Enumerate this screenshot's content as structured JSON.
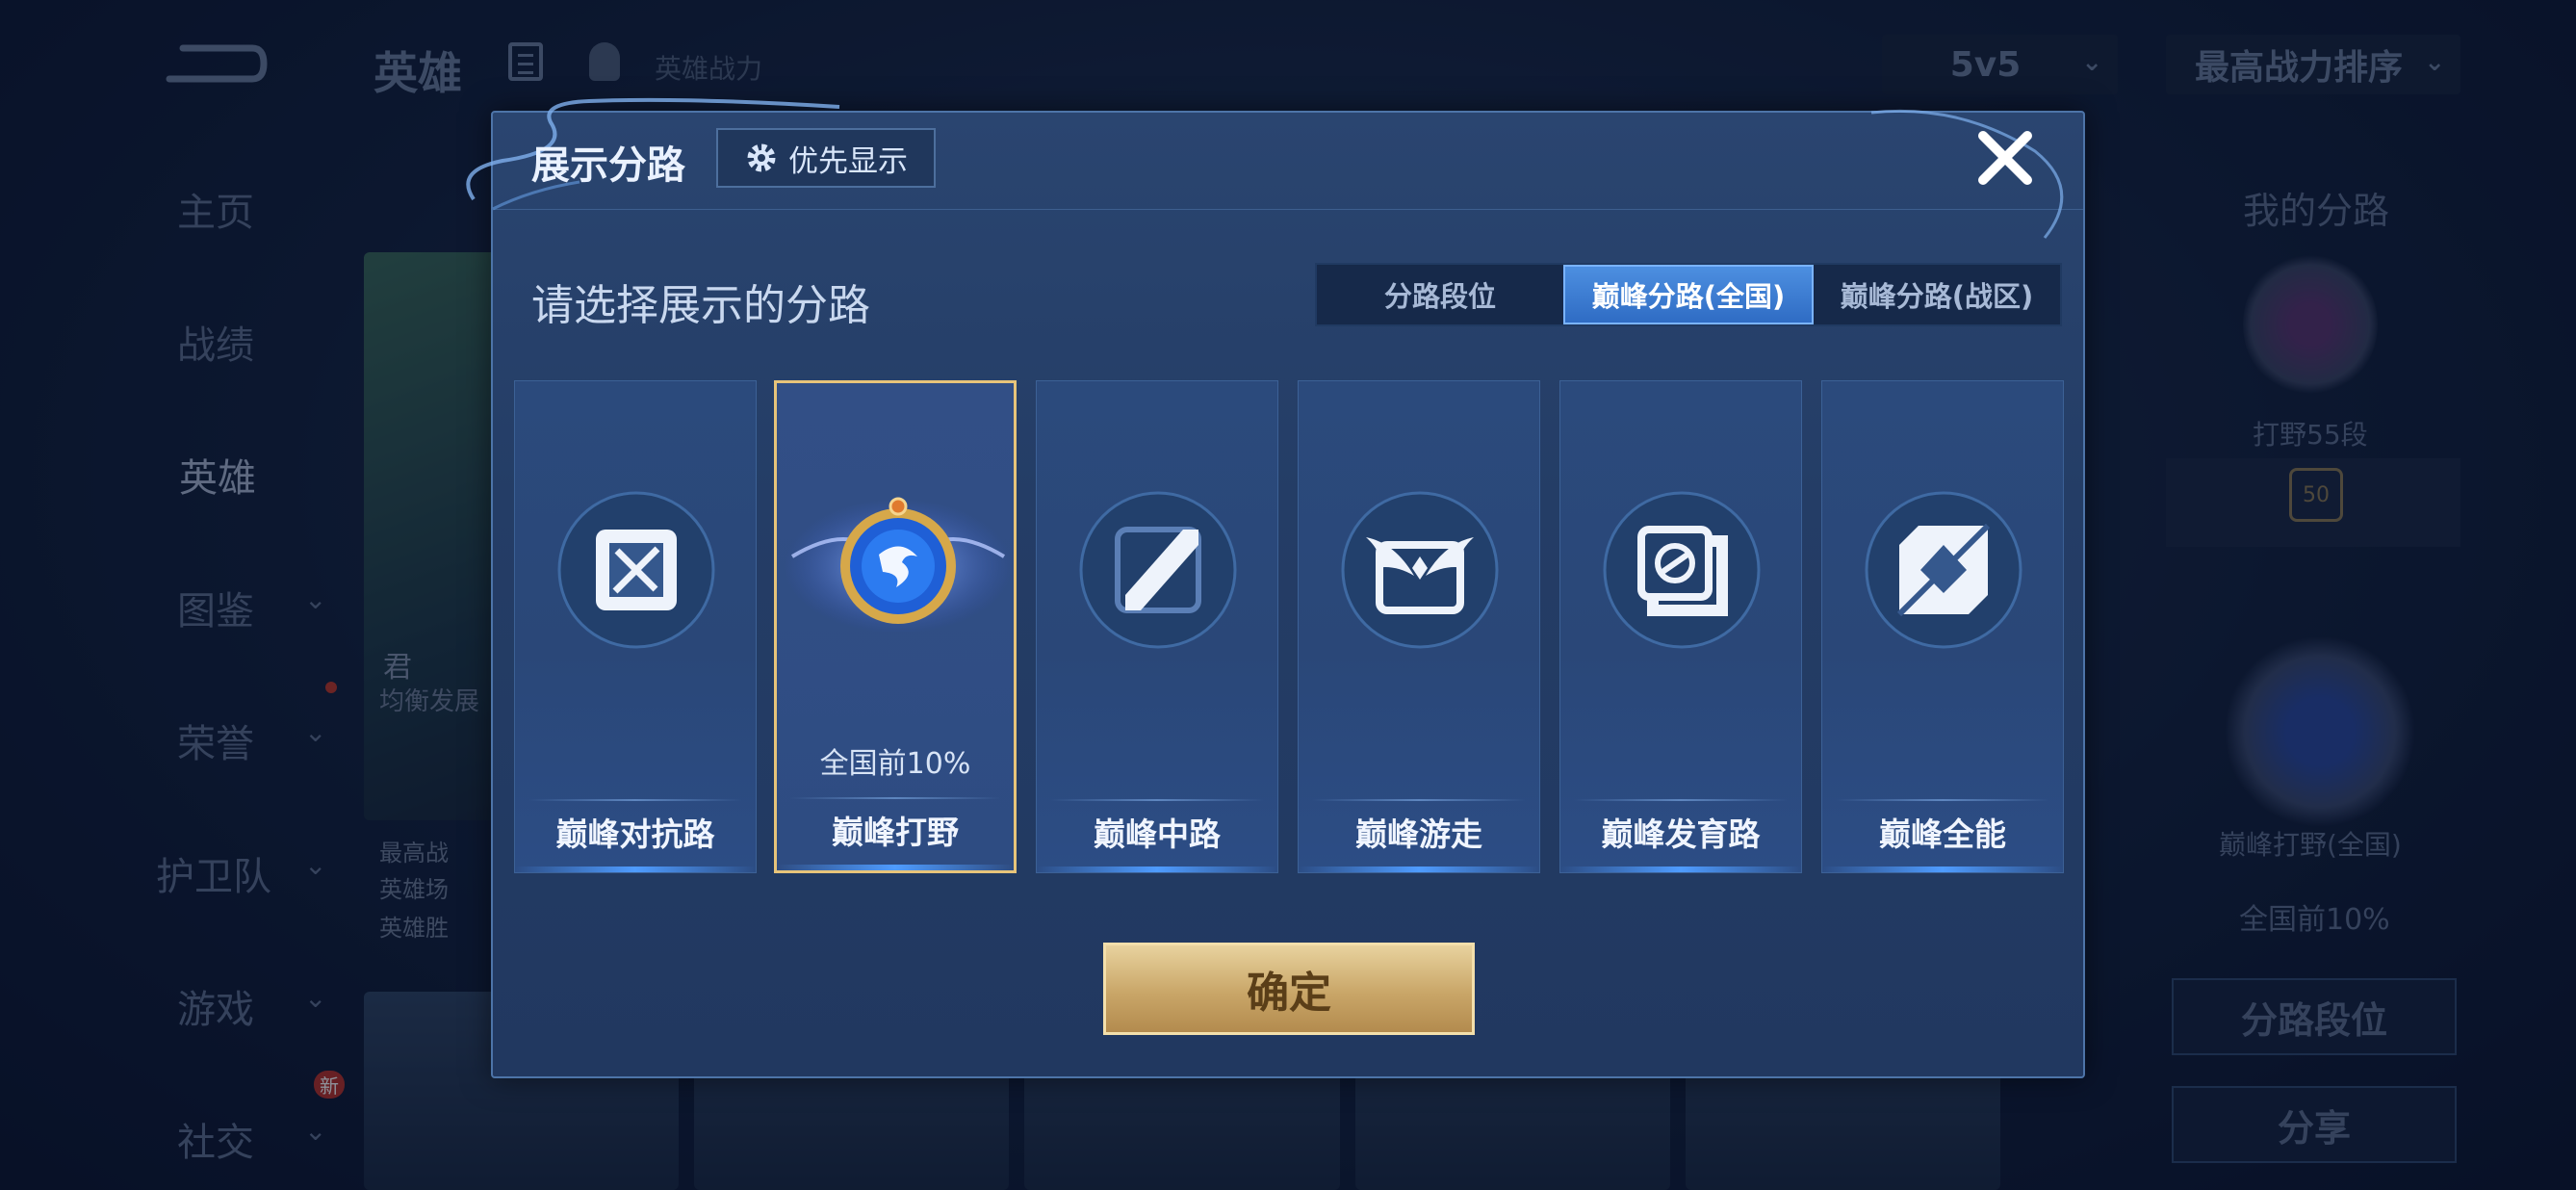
{
  "background": {
    "title": "英雄",
    "power_label": "英雄战力",
    "mode_select": "5v5",
    "sort_select": "最高战力排序",
    "sidebar": [
      {
        "label": "主页"
      },
      {
        "label": "战绩"
      },
      {
        "label": "英雄"
      },
      {
        "label": "图鉴"
      },
      {
        "label": "荣誉"
      },
      {
        "label": "护卫队"
      },
      {
        "label": "游戏"
      },
      {
        "label": "社交"
      }
    ],
    "new_badge": "新",
    "hero_card": {
      "name_partial": "君",
      "role_partial": "均衡发展",
      "stats_partial": [
        "最高战",
        "英雄场",
        "英雄胜"
      ]
    },
    "right_panel": {
      "title": "我的分路",
      "rank": "打野55段",
      "level": "50",
      "peak_name": "巅峰打野(全国)",
      "peak_rank": "全国前10%",
      "btn_lane": "分路段位",
      "btn_share": "分享"
    }
  },
  "modal": {
    "title": "展示分路",
    "priority_button": "优先显示",
    "subtitle": "请选择展示的分路",
    "tabs": [
      {
        "label": "分路段位",
        "active": false
      },
      {
        "label": "巅峰分路(全国)",
        "active": true
      },
      {
        "label": "巅峰分路(战区)",
        "active": false
      }
    ],
    "cards": [
      {
        "name": "巅峰对抗路",
        "icon": "clash-lane-icon",
        "rank": "",
        "selected": false
      },
      {
        "name": "巅峰打野",
        "icon": "jungle-dragon-icon",
        "rank": "全国前10%",
        "selected": true
      },
      {
        "name": "巅峰中路",
        "icon": "mid-lane-icon",
        "rank": "",
        "selected": false
      },
      {
        "name": "巅峰游走",
        "icon": "roam-wings-icon",
        "rank": "",
        "selected": false
      },
      {
        "name": "巅峰发育路",
        "icon": "farm-lane-icon",
        "rank": "",
        "selected": false
      },
      {
        "name": "巅峰全能",
        "icon": "all-round-icon",
        "rank": "",
        "selected": false
      }
    ],
    "confirm_button": "确定"
  },
  "colors": {
    "modal_bg": "#243d66",
    "tab_active": "#3b7ad6",
    "selected_border": "#e7c47a",
    "confirm_gold": "#c9a668"
  }
}
